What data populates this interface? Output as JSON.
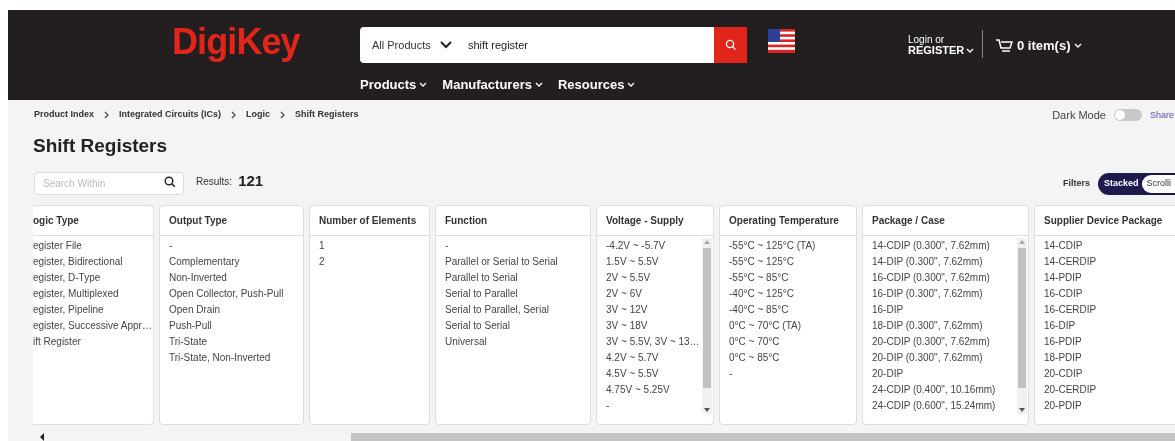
{
  "header": {
    "logo": "DigiKey",
    "search_category": "All Products",
    "search_value": "shift register",
    "login_small": "Login or",
    "login_link": "REGISTER",
    "cart": "0 item(s)"
  },
  "nav": [
    "Products",
    "Manufacturers",
    "Resources"
  ],
  "breadcrumbs": [
    "Product Index",
    "Integrated Circuits (ICs)",
    "Logic",
    "Shift Registers"
  ],
  "title": "Shift Registers",
  "dark_mode": {
    "label": "Dark Mode",
    "on": false
  },
  "share": "Share",
  "search_within": {
    "placeholder": "Search Within"
  },
  "results": {
    "label": "Results:",
    "count": "121"
  },
  "filters": {
    "label": "Filters",
    "views": [
      {
        "label": "Stacked",
        "selected": true
      },
      {
        "label": "Scrolli",
        "selected": false
      }
    ]
  },
  "columns": [
    {
      "title": "ogic Type",
      "scrollable": false,
      "values": [
        "egister File",
        "egister, Bidirectional",
        "egister, D-Type",
        "egister, Multiplexed",
        "egister, Pipeline",
        "egister, Successive Appr…",
        "ift Register"
      ]
    },
    {
      "title": "Output Type",
      "scrollable": false,
      "values": [
        "-",
        "Complementary",
        "Non-Inverted",
        "Open Collector, Push-Pull",
        "Open Drain",
        "Push-Pull",
        "Tri-State",
        "Tri-State, Non-Inverted"
      ]
    },
    {
      "title": "Number of Elements",
      "scrollable": false,
      "values": [
        "1",
        "2"
      ]
    },
    {
      "title": "Function",
      "scrollable": false,
      "values": [
        "-",
        "Parallel or Serial to Serial",
        "Parallel to Serial",
        "Serial to Parallel",
        "Serial to Parallel, Serial",
        "Serial to Serial",
        "Universal"
      ]
    },
    {
      "title": "Voltage - Supply",
      "scrollable": true,
      "values": [
        "-4.2V ~ -5.7V",
        "1.5V ~ 5.5V",
        "2V ~ 5.5V",
        "2V ~ 6V",
        "3V ~ 12V",
        "3V ~ 18V",
        "3V ~ 5.5V, 3V ~ 13…",
        "4.2V ~ 5.7V",
        "4.5V ~ 5.5V",
        "4.75V ~ 5.25V",
        "-"
      ]
    },
    {
      "title": "Operating Temperature",
      "scrollable": false,
      "values": [
        "-55°C ~ 125°C (TA)",
        "-55°C ~ 125°C",
        "-55°C ~ 85°C",
        "-40°C ~ 125°C",
        "-40°C ~ 85°C",
        "0°C ~ 70°C (TA)",
        "0°C ~ 70°C",
        "0°C ~ 85°C",
        "-"
      ]
    },
    {
      "title": "Package / Case",
      "scrollable": true,
      "values": [
        "14-CDIP (0.300\", 7.62mm)",
        "14-DIP (0.300\", 7.62mm)",
        "16-CDIP (0.300\", 7.62mm)",
        "16-DIP (0.300\", 7.62mm)",
        "16-DIP",
        "18-DIP (0.300\", 7.62mm)",
        "20-CDIP (0.300\", 7.62mm)",
        "20-DIP (0.300\", 7.62mm)",
        "20-DIP",
        "24-CDIP (0.400\", 10.16mm)",
        "24-CDIP (0.600\", 15.24mm)"
      ]
    },
    {
      "title": "Supplier Device Package",
      "scrollable": false,
      "values": [
        "14-CDIP",
        "14-CERDIP",
        "14-PDIP",
        "16-CDIP",
        "16-CERDIP",
        "16-DIP",
        "16-PDIP",
        "18-PDIP",
        "20-CDIP",
        "20-CERDIP",
        "20-PDIP"
      ]
    }
  ]
}
